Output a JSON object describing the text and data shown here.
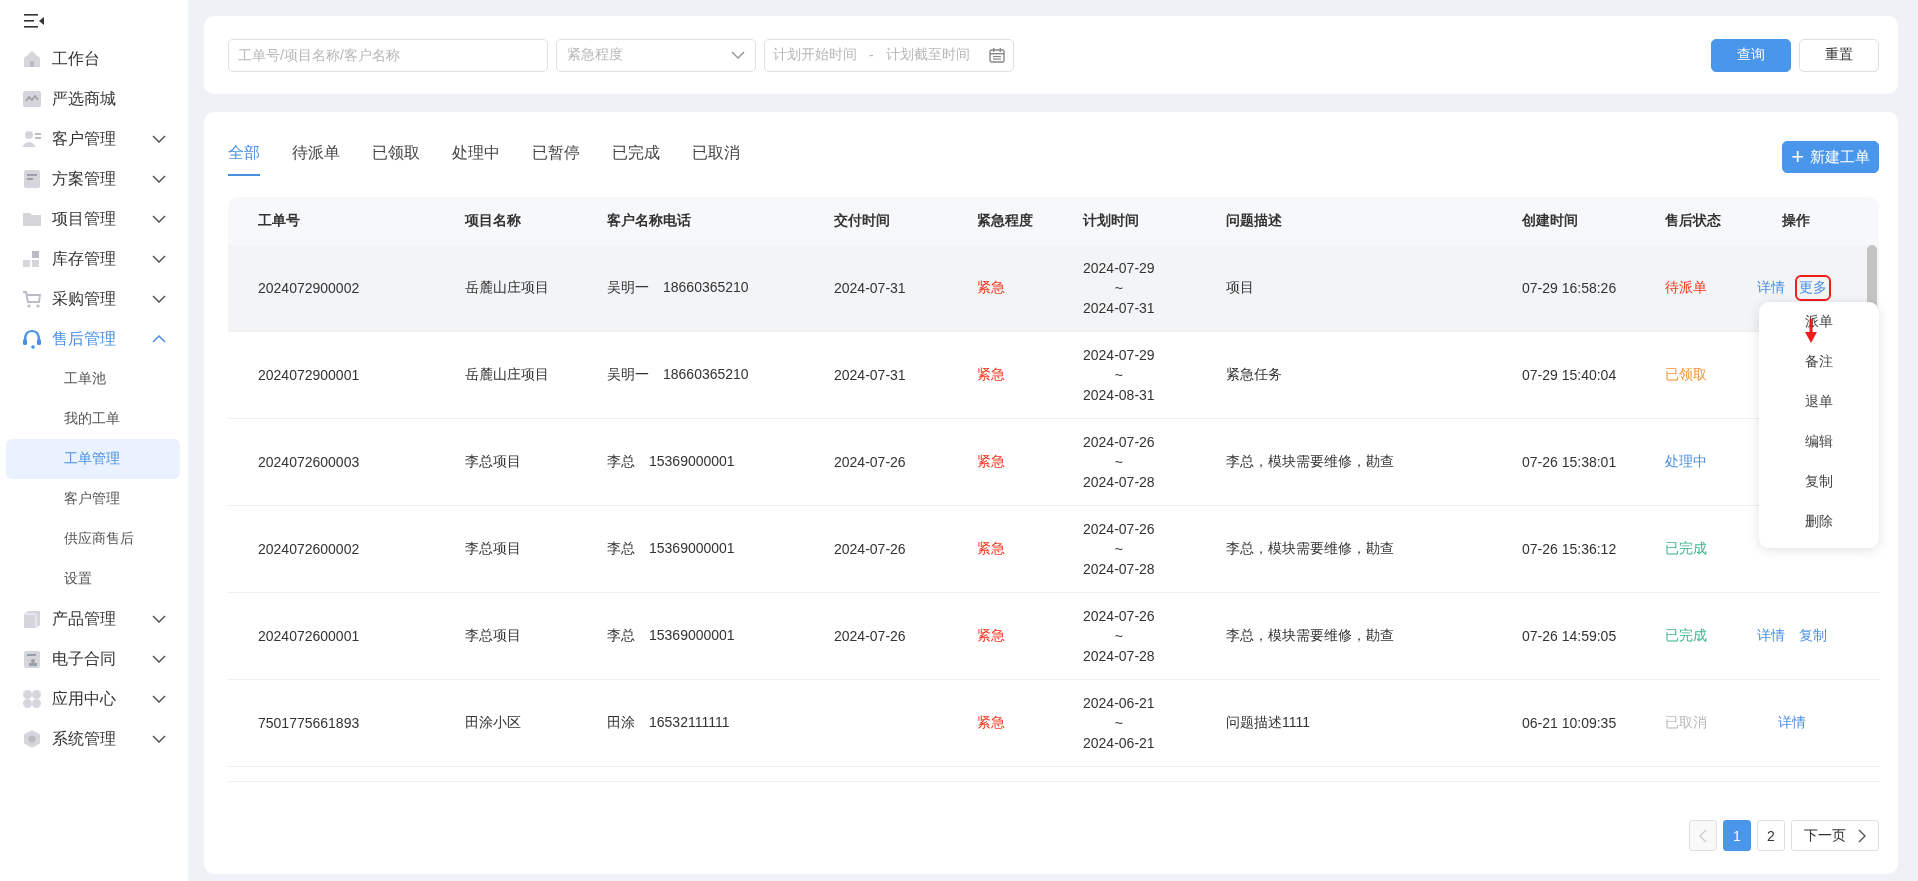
{
  "sidebar": {
    "items": [
      {
        "label": "工作台",
        "kind": "link",
        "active": false
      },
      {
        "label": "严选商城",
        "kind": "link",
        "active": false
      },
      {
        "label": "客户管理",
        "kind": "group",
        "expanded": false,
        "active": false
      },
      {
        "label": "方案管理",
        "kind": "group",
        "expanded": false,
        "active": false
      },
      {
        "label": "项目管理",
        "kind": "group",
        "expanded": false,
        "active": false
      },
      {
        "label": "库存管理",
        "kind": "group",
        "expanded": false,
        "active": false
      },
      {
        "label": "采购管理",
        "kind": "group",
        "expanded": false,
        "active": false
      },
      {
        "label": "售后管理",
        "kind": "group",
        "expanded": true,
        "active": true,
        "children": [
          {
            "label": "工单池",
            "selected": false
          },
          {
            "label": "我的工单",
            "selected": false
          },
          {
            "label": "工单管理",
            "selected": true
          },
          {
            "label": "客户管理",
            "selected": false
          },
          {
            "label": "供应商售后",
            "selected": false
          },
          {
            "label": "设置",
            "selected": false
          }
        ]
      },
      {
        "label": "产品管理",
        "kind": "group",
        "expanded": false,
        "active": false
      },
      {
        "label": "电子合同",
        "kind": "group",
        "expanded": false,
        "active": false
      },
      {
        "label": "应用中心",
        "kind": "group",
        "expanded": false,
        "active": false
      },
      {
        "label": "系统管理",
        "kind": "group",
        "expanded": false,
        "active": false
      }
    ]
  },
  "filters": {
    "search": {
      "placeholder": "工单号/项目名称/客户名称"
    },
    "urgency": {
      "placeholder": "紧急程度"
    },
    "date_range": {
      "start_placeholder": "计划开始时间",
      "separator": "-",
      "end_placeholder": "计划截至时间"
    },
    "buttons": [
      {
        "label": "查询",
        "kind": "primary"
      },
      {
        "label": "重置",
        "kind": "default"
      }
    ]
  },
  "tabs": [
    {
      "label": "全部",
      "selected": true
    },
    {
      "label": "待派单",
      "selected": false
    },
    {
      "label": "已领取",
      "selected": false
    },
    {
      "label": "处理中",
      "selected": false
    },
    {
      "label": "已暂停",
      "selected": false
    },
    {
      "label": "已完成",
      "selected": false
    },
    {
      "label": "已取消",
      "selected": false
    }
  ],
  "new_button": {
    "icon": "+",
    "label": "新建工单"
  },
  "table": {
    "columns": [
      "工单号",
      "项目名称",
      "客户名称电话",
      "交付时间",
      "紧急程度",
      "计划时间",
      "问题描述",
      "创建时间",
      "售后状态",
      "操作"
    ],
    "rows": [
      {
        "hovered": true,
        "id": "2024072900002",
        "project": "岳麓山庄项目",
        "customer": "吴明一",
        "phone": "18660365210",
        "delivery": "2024-07-31",
        "urgency": {
          "label": "紧急",
          "color": "#f5371f"
        },
        "plan": {
          "start": "2024-07-29",
          "sep": "~",
          "end": "2024-07-31"
        },
        "description": "项目",
        "created": "07-29 16:58:26",
        "status": {
          "label": "待派单",
          "color": "#f5371f"
        },
        "actions": [
          {
            "label": "详情",
            "highlighted": false
          },
          {
            "label": "更多",
            "highlighted": true
          }
        ]
      },
      {
        "hovered": false,
        "id": "2024072900001",
        "project": "岳麓山庄项目",
        "customer": "吴明一",
        "phone": "18660365210",
        "delivery": "2024-07-31",
        "urgency": {
          "label": "紧急",
          "color": "#f5371f"
        },
        "plan": {
          "start": "2024-07-29",
          "sep": "~",
          "end": "2024-08-31"
        },
        "description": "紧急任务",
        "created": "07-29 15:40:04",
        "status": {
          "label": "已领取",
          "color": "#f7922e"
        },
        "actions": []
      },
      {
        "hovered": false,
        "id": "2024072600003",
        "project": "李总项目",
        "customer": "李总",
        "phone": "15369000001",
        "delivery": "2024-07-26",
        "urgency": {
          "label": "紧急",
          "color": "#f5371f"
        },
        "plan": {
          "start": "2024-07-26",
          "sep": "~",
          "end": "2024-07-28"
        },
        "description": "李总，模块需要维修，勘查",
        "created": "07-26 15:38:01",
        "status": {
          "label": "处理中",
          "color": "#4a90e2"
        },
        "actions": []
      },
      {
        "hovered": false,
        "id": "2024072600002",
        "project": "李总项目",
        "customer": "李总",
        "phone": "15369000001",
        "delivery": "2024-07-26",
        "urgency": {
          "label": "紧急",
          "color": "#f5371f"
        },
        "plan": {
          "start": "2024-07-26",
          "sep": "~",
          "end": "2024-07-28"
        },
        "description": "李总，模块需要维修，勘查",
        "created": "07-26 15:36:12",
        "status": {
          "label": "已完成",
          "color": "#3cb68e"
        },
        "actions": []
      },
      {
        "hovered": false,
        "id": "2024072600001",
        "project": "李总项目",
        "customer": "李总",
        "phone": "15369000001",
        "delivery": "2024-07-26",
        "urgency": {
          "label": "紧急",
          "color": "#f5371f"
        },
        "plan": {
          "start": "2024-07-26",
          "sep": "~",
          "end": "2024-07-28"
        },
        "description": "李总，模块需要维修，勘查",
        "created": "07-26 14:59:05",
        "status": {
          "label": "已完成",
          "color": "#3cb68e"
        },
        "actions": [
          {
            "label": "详情",
            "highlighted": false
          },
          {
            "label": "复制",
            "highlighted": false
          }
        ]
      },
      {
        "hovered": false,
        "id": "7501775661893",
        "project": "田涂小区",
        "customer": "田涂",
        "phone": "16532111111",
        "urgency": {
          "label": "紧急",
          "color": "#f5371f"
        },
        "plan": {
          "start": "2024-06-21",
          "sep": "~",
          "end": "2024-06-21"
        },
        "description": "问题描述1111",
        "created": "06-21 10:09:35",
        "status": {
          "label": "已取消",
          "color": "#b8b8b8"
        },
        "actions": [
          {
            "label": "详情",
            "highlighted": false
          }
        ]
      }
    ]
  },
  "more_menu": {
    "items": [
      "派单",
      "备注",
      "退单",
      "编辑",
      "复制",
      "删除"
    ]
  },
  "pagination": {
    "pages": [
      {
        "label": "1",
        "selected": true
      },
      {
        "label": "2",
        "selected": false
      }
    ],
    "prev_disabled": true,
    "next_label": "下一页"
  }
}
